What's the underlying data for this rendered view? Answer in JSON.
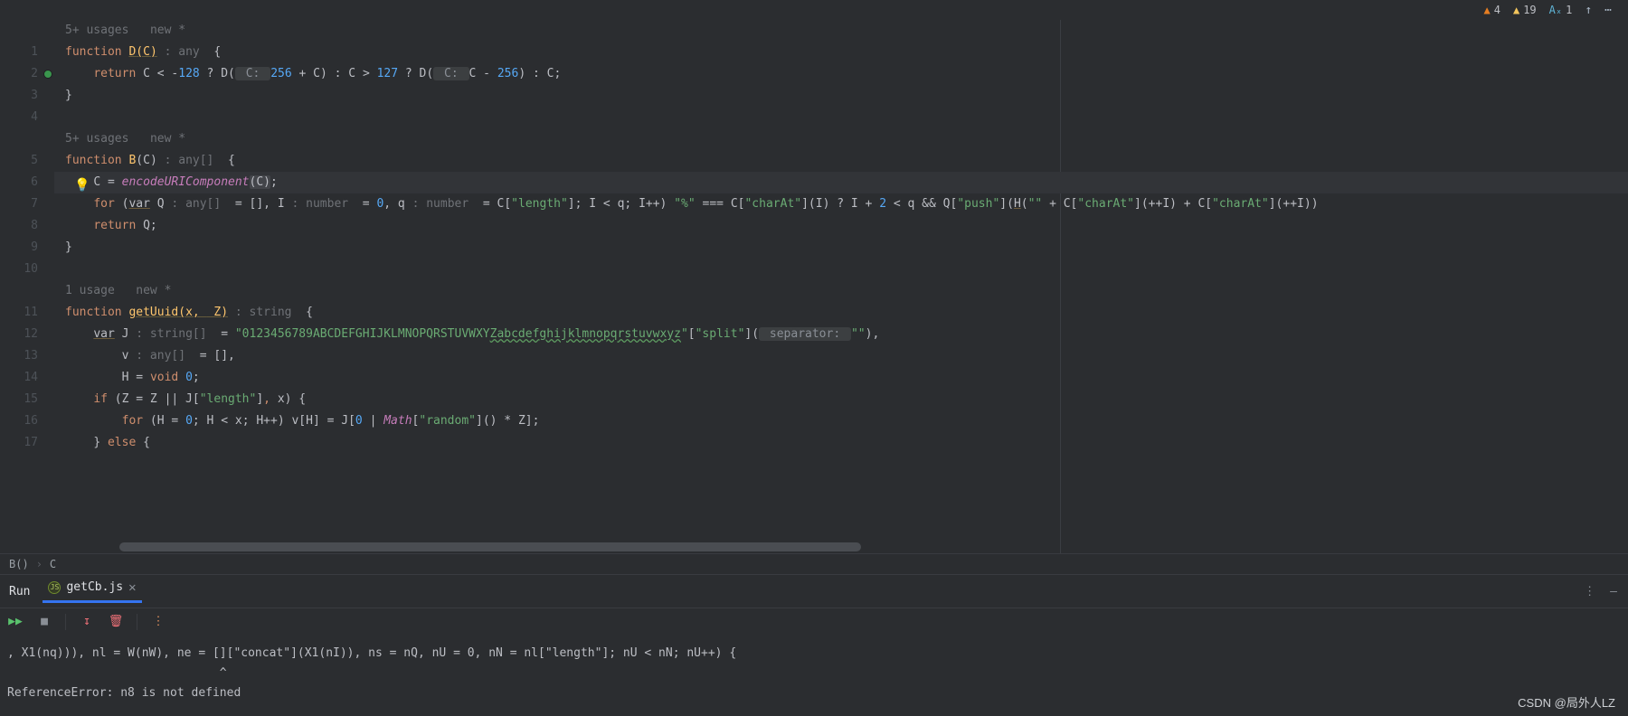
{
  "inspections": {
    "error": {
      "icon": "▲",
      "count": "4"
    },
    "warn": {
      "icon": "▲",
      "count": "19"
    },
    "typo": {
      "icon": "Aₓ",
      "count": "1"
    },
    "arrow": "↑",
    "more": "⋯"
  },
  "gutter": [
    "1",
    "2",
    "3",
    "4",
    "5",
    "6",
    "7",
    "8",
    "9",
    "10",
    "11",
    "12",
    "13",
    "14",
    "15",
    "16",
    "17"
  ],
  "code": {
    "hl_line_index": 5,
    "hint1": {
      "usages": "5+ usages",
      "new": "new *"
    },
    "l1": {
      "fn": "function",
      "name": "D",
      "openp": "(",
      "p": "C",
      "closep": ")",
      "thint": " : any ",
      "ob": " {"
    },
    "l2": {
      "pad": "    ",
      "ret": "return",
      "c1": " C < -",
      "n1": "128",
      "q1": " ? D(",
      "ph1": " C: ",
      "n2": "256",
      "plus": " + C) : C > ",
      "n3": "127",
      "q2": " ? D(",
      "ph2": " C: ",
      "body3": "C - ",
      "n4": "256",
      "tail": ") : C;"
    },
    "l3": "}",
    "hint2": {
      "usages": "5+ usages",
      "new": "new *"
    },
    "l5": {
      "fn": "function",
      "name": " B",
      "openp": "(",
      "p": "C",
      "closep": ")",
      "thint": " : any[] ",
      "ob": " {"
    },
    "l6": {
      "pad": "    ",
      "c": "C = ",
      "enc": "encodeURIComponent",
      "args": "(C)",
      "semi": ";"
    },
    "l7": {
      "pad": "    ",
      "for": "for",
      "op": " (",
      "var": "var",
      "q": " Q ",
      "th1": ": any[] ",
      "eq1": " = [], I ",
      "th2": ": number ",
      "eq2": " = ",
      "z": "0",
      "cm": ", q ",
      "th3": ": number ",
      "eq3": " = C[",
      "s1": "\"length\"",
      "mid": "]; I < q; I++) ",
      "s2": "\"%\"",
      "eqq": " === C[",
      "s3": "\"charAt\"",
      "r1": "](I) ? I + ",
      "n2": "2",
      "r2": " < q && Q[",
      "s4": "\"push\"",
      "r3": "](",
      "h": "H",
      "r4": "(",
      "s5": "\"\"",
      "r5": " + C[",
      "s6": "\"charAt\"",
      "r6": "](++I) + C[",
      "s7": "\"charAt\"",
      "r7": "](++I))"
    },
    "l8": {
      "pad": "    ",
      "ret": "return",
      "body": " Q;"
    },
    "l9": "}",
    "hint3": {
      "usages": "1 usage",
      "new": "new *"
    },
    "l11": {
      "fn": "function",
      "name": "getUuid",
      "openp": "(",
      "p1": "x",
      "cm": ", ",
      "p2": " Z",
      "closep": ")",
      "thint": " : string ",
      "ob": " {"
    },
    "l12": {
      "pad": "    ",
      "var": "var",
      "j": " J ",
      "th": ": string[] ",
      "eq": " = ",
      "s1": "\"0123456789ABCDEFGHIJKLMNOPQRSTUVWXY",
      "s2": "Zabcdefghijklmnopqrstuvwxyz",
      "s3": "\"",
      "b1": "[",
      "s4": "\"split\"",
      "b2": "](",
      "ph": " separator: ",
      "s5": "\"\"",
      "tail": "),"
    },
    "l13": {
      "pad": "        ",
      "v": "v ",
      "th": ": any[] ",
      "eq": " = [],"
    },
    "l14": {
      "pad": "        ",
      "h": "H = ",
      "void": "void",
      "sp": " ",
      "z": "0",
      "semi": ";"
    },
    "l15": {
      "pad": "    ",
      "if": "if",
      "body": " (Z = Z || J[",
      "s": "\"length\"",
      "b2": "]",
      "comma": ",",
      "body2": " x) {"
    },
    "l16": {
      "pad": "        ",
      "for": "for",
      "body": " (H = ",
      "z1": "0",
      "b2": "; H < x; H++) v[H] = J[",
      "z2": "0",
      "mid": " | ",
      "math": "Math",
      "b3": "[",
      "s": "\"random\"",
      "tail": "]() * Z];"
    },
    "l17": {
      "pad": "    ",
      "body": "} ",
      "else": "else",
      "ob": " {"
    }
  },
  "breadcrumb": {
    "a": "B()",
    "sep": "›",
    "b": "C"
  },
  "toolwindow": {
    "title": "Run",
    "tab": {
      "file": "getCb.js",
      "close": "✕"
    },
    "more": "⋮"
  },
  "toolbar": {
    "rerun": "▶▶",
    "stop": "■",
    "down": "↧",
    "trash": "🗑",
    "kebab": "⋮"
  },
  "console": {
    "line1": ", X1(nq))), nl = W(nW), ne = []​[\"concat\"](X1(nI)), ns = nQ, nU = 0, nN = nl[\"length\"]; nU < nN; nU++) {",
    "line2": "                              ^",
    "blank": "",
    "err": "ReferenceError: n8 is not defined"
  },
  "watermark": "CSDN @局外人LZ"
}
